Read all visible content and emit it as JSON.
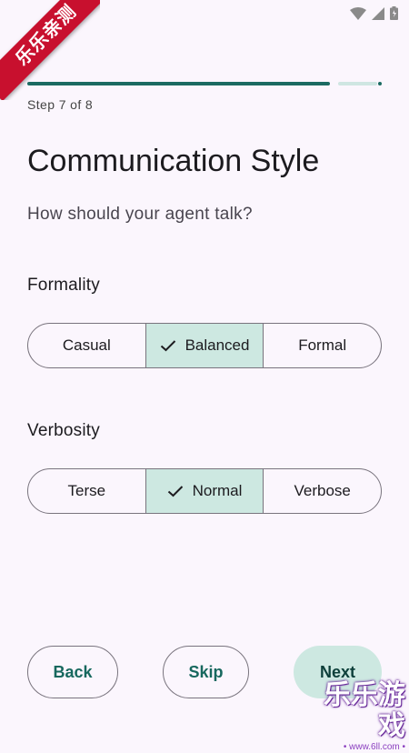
{
  "badge": "乐乐亲测",
  "progress": {
    "value": 0.875
  },
  "step_label": "Step 7 of 8",
  "title": "Communication Style",
  "subtitle": "How should your agent talk?",
  "formality": {
    "label": "Formality",
    "options": [
      "Casual",
      "Balanced",
      "Formal"
    ],
    "selected": "Balanced"
  },
  "verbosity": {
    "label": "Verbosity",
    "options": [
      "Terse",
      "Normal",
      "Verbose"
    ],
    "selected": "Normal"
  },
  "buttons": {
    "back": "Back",
    "skip": "Skip",
    "next": "Next"
  },
  "watermark": {
    "text": "乐乐游戏",
    "url": "• www.6ll.com •"
  },
  "colors": {
    "accent": "#1b6b62",
    "selected_bg": "#cde8e1",
    "background": "#fbf6fd"
  },
  "icons": [
    "wifi-icon",
    "cell-signal-icon",
    "battery-icon",
    "check-icon"
  ]
}
